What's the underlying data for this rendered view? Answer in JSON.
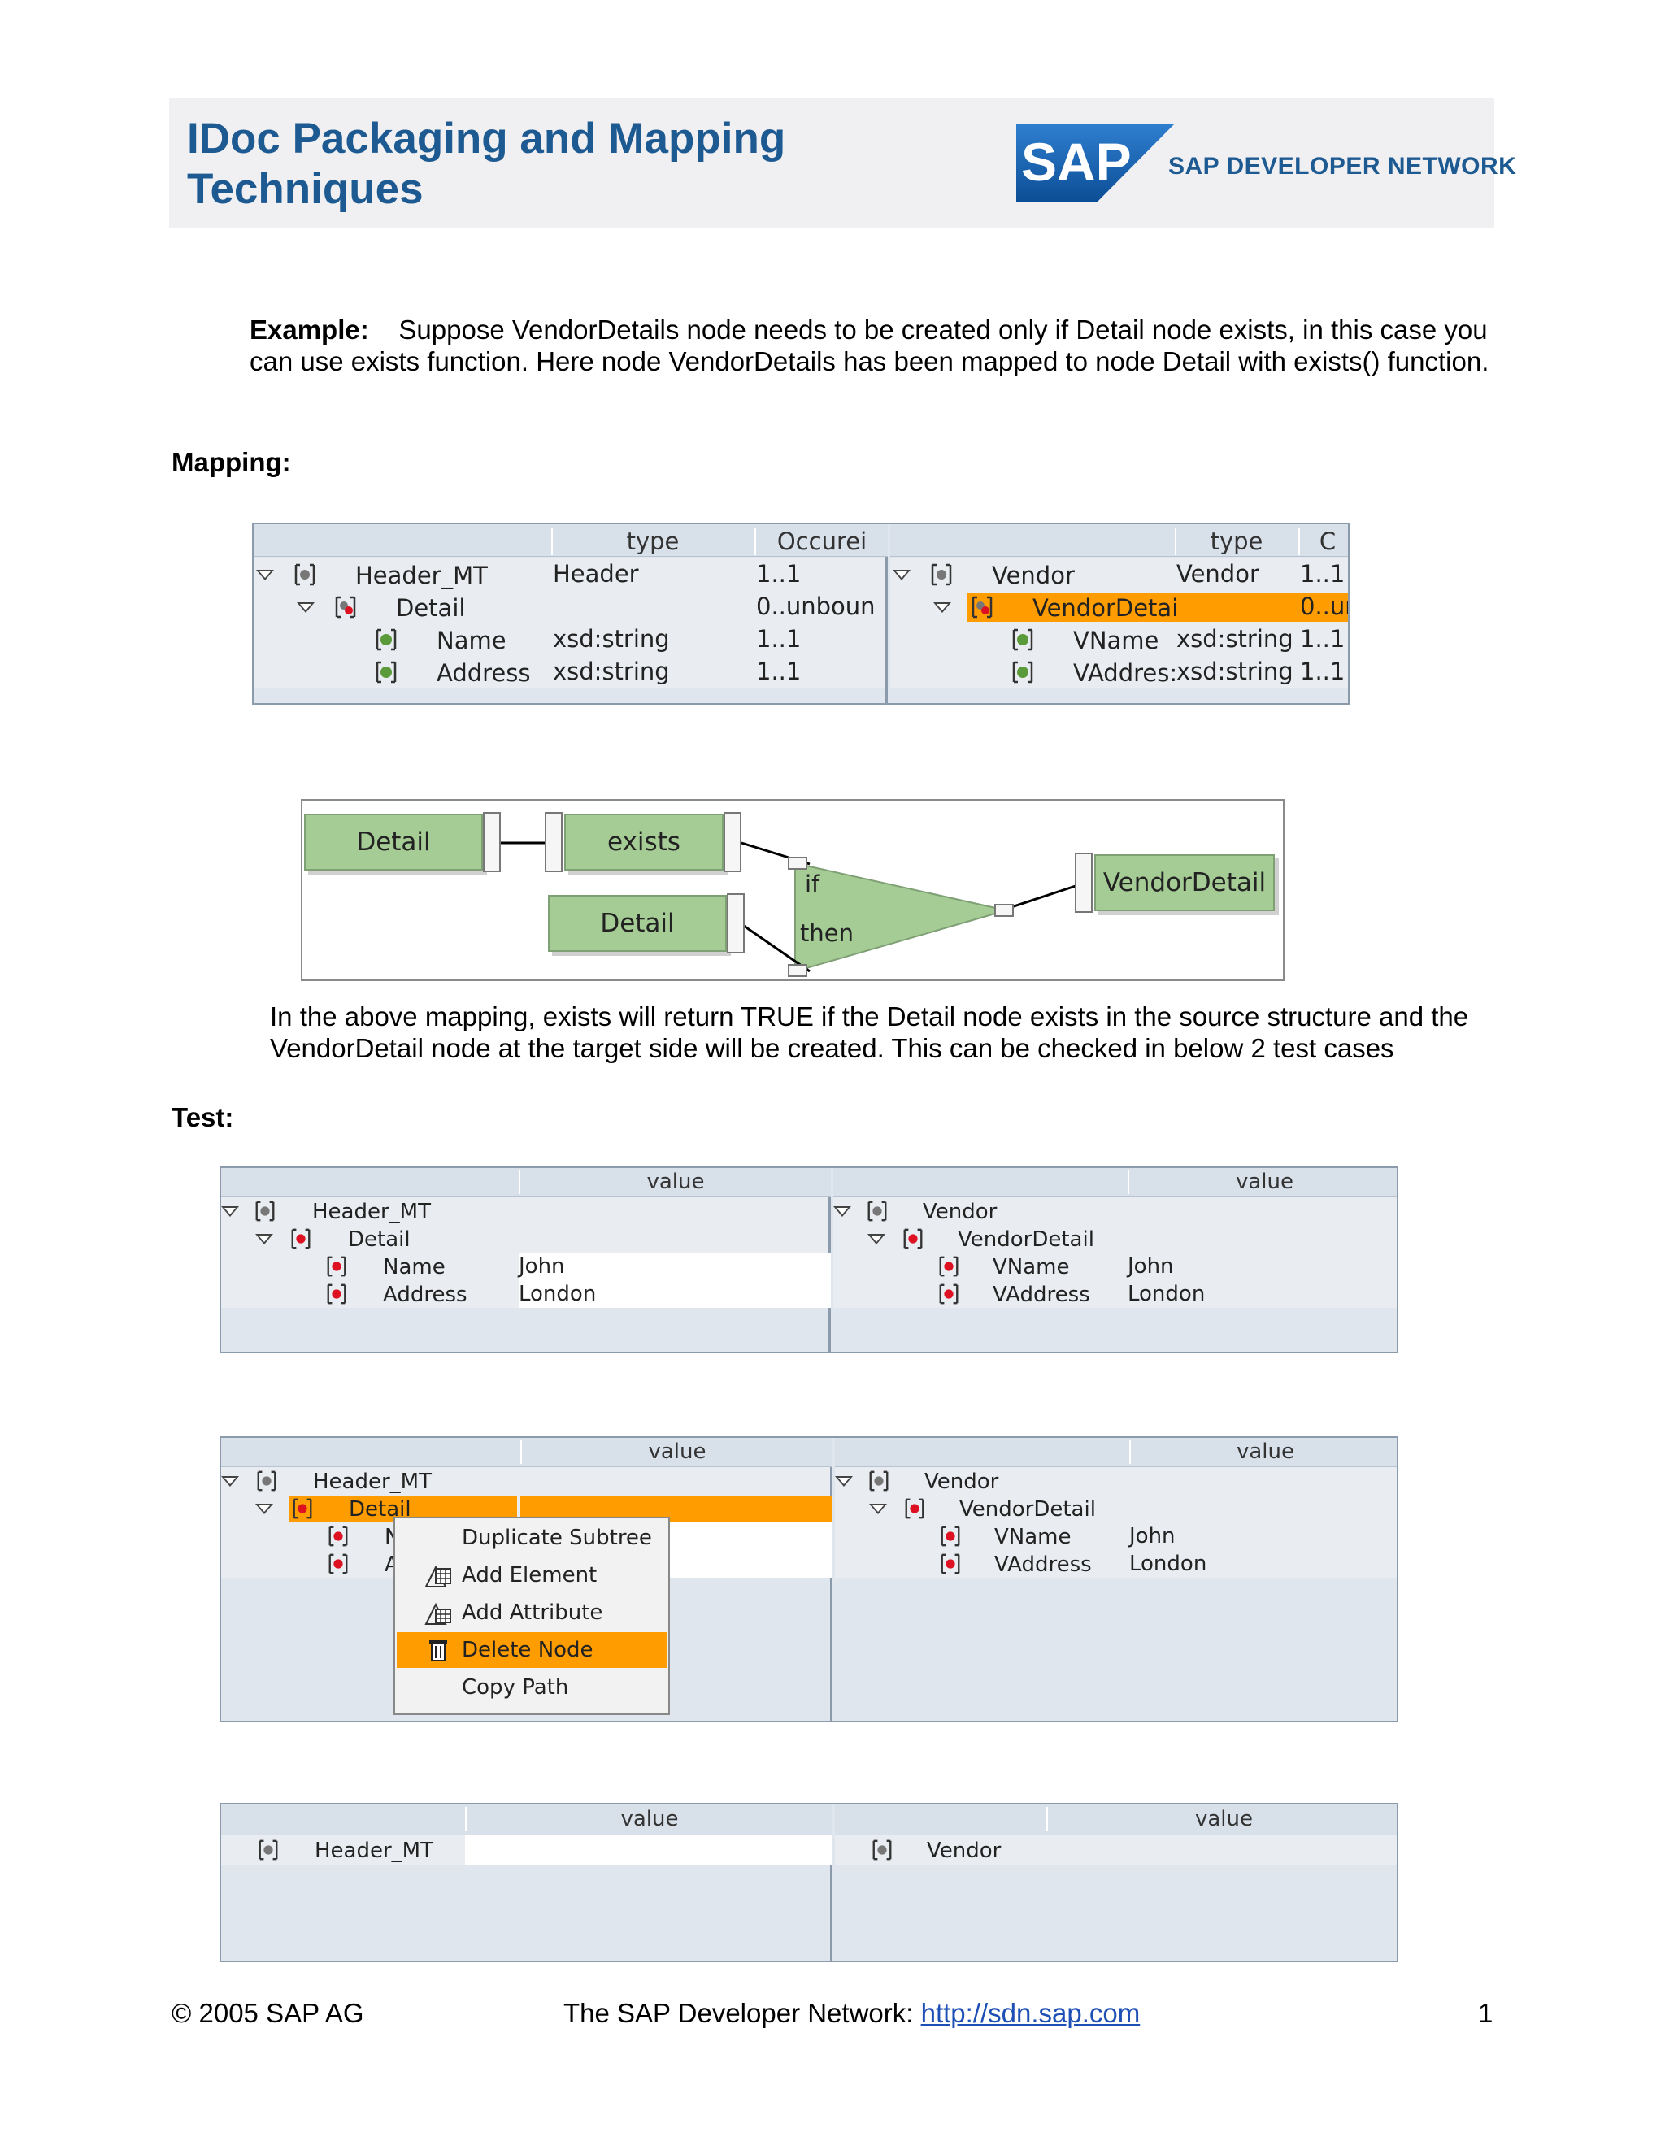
{
  "header": {
    "title_line1": "IDoc Packaging and Mapping",
    "title_line2": "Techniques",
    "logo_text": "SAP",
    "network_text": "SAP DEVELOPER NETWORK"
  },
  "example": {
    "label": "Example:",
    "text": "Suppose VendorDetails node needs to be created only if Detail node exists, in this case you can use exists function. Here node VendorDetails has been mapped to node Detail with exists() function."
  },
  "mapping_heading": "Mapping:",
  "mapping_table": {
    "source": {
      "col_type": "type",
      "col_occ": "Occurei",
      "rows": [
        {
          "name": "Header_MT",
          "type": "Header",
          "occ": "1..1"
        },
        {
          "name": "Detail",
          "type": "",
          "occ": "0..unboun"
        },
        {
          "name": "Name",
          "type": "xsd:string",
          "occ": "1..1"
        },
        {
          "name": "Address",
          "type": "xsd:string",
          "occ": "1..1"
        }
      ]
    },
    "target": {
      "col_type": "type",
      "col_occ": "C",
      "rows": [
        {
          "name": "Vendor",
          "type": "Vendor",
          "occ": "1..1"
        },
        {
          "name": "VendorDetai",
          "type": "",
          "occ": "0..ur"
        },
        {
          "name": "VName",
          "type": "xsd:string",
          "occ": "1..1"
        },
        {
          "name": "VAddres:",
          "type": "xsd:string",
          "occ": "1..1"
        }
      ]
    }
  },
  "diagram": {
    "source_detail_1": "Detail",
    "exists_fn": "exists",
    "source_detail_2": "Detail",
    "if_label": "if",
    "then_label": "then",
    "target_node": "VendorDetail"
  },
  "explain": "In the above mapping, exists will return TRUE if the Detail node exists in the source structure and the VendorDetail node at the target side will be created. This can be checked in below 2 test cases",
  "test_heading": "Test:",
  "test1": {
    "col_value": "value",
    "source_rows": [
      {
        "name": "Header_MT",
        "value": ""
      },
      {
        "name": "Detail",
        "value": ""
      },
      {
        "name": "Name",
        "value": "John"
      },
      {
        "name": "Address",
        "value": "London"
      }
    ],
    "target_rows": [
      {
        "name": "Vendor",
        "value": ""
      },
      {
        "name": "VendorDetail",
        "value": ""
      },
      {
        "name": "VName",
        "value": "John"
      },
      {
        "name": "VAddress",
        "value": "London"
      }
    ]
  },
  "test2": {
    "col_value": "value",
    "source_rows": [
      {
        "name": "Header_MT",
        "value": ""
      },
      {
        "name": "Detail",
        "value": ""
      },
      {
        "name": "N",
        "value": ""
      },
      {
        "name": "A",
        "value": ""
      }
    ],
    "target_rows": [
      {
        "name": "Vendor",
        "value": ""
      },
      {
        "name": "VendorDetail",
        "value": ""
      },
      {
        "name": "VName",
        "value": "John"
      },
      {
        "name": "VAddress",
        "value": "London"
      }
    ],
    "context_menu": [
      "Duplicate Subtree",
      "Add Element",
      "Add Attribute",
      "Delete Node",
      "Copy Path"
    ]
  },
  "test3": {
    "col_value": "value",
    "source_root": "Header_MT",
    "target_root": "Vendor"
  },
  "footer": {
    "copyright": "© 2005 SAP AG",
    "network_label": "The SAP Developer Network: ",
    "link": "http://sdn.sap.com",
    "page": "1"
  },
  "colors": {
    "title_blue": "#1e5a92",
    "selection_orange": "#ff9c00",
    "function_green": "#a5cc95",
    "link_blue": "#1d4fb5"
  }
}
